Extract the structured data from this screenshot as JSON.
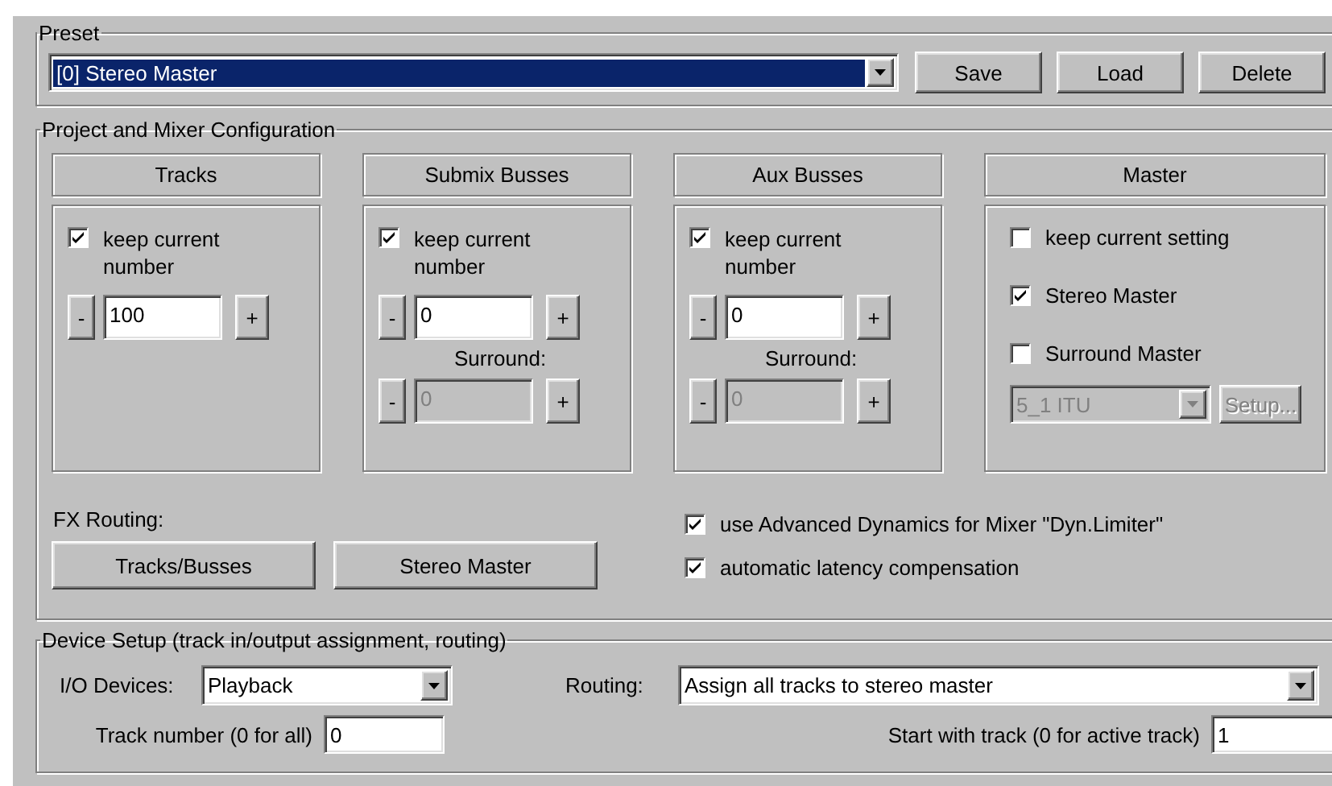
{
  "preset": {
    "title": "Preset",
    "selected": "[0] Stereo Master",
    "buttons": [
      "Save",
      "Load",
      "Delete"
    ]
  },
  "mixer": {
    "title": "Project and Mixer Configuration",
    "columns": [
      {
        "kind": "count",
        "title": "Tracks",
        "keep": {
          "label": "keep current number",
          "checked": true
        },
        "spin": {
          "minus": "-",
          "value": "100",
          "plus": "+"
        }
      },
      {
        "kind": "count",
        "title": "Submix Busses",
        "keep": {
          "label": "keep current number",
          "checked": true
        },
        "spin": {
          "minus": "-",
          "value": "0",
          "plus": "+"
        },
        "surround": {
          "label": "Surround:",
          "minus": "-",
          "value": "0",
          "plus": "+",
          "disabled": true
        }
      },
      {
        "kind": "count",
        "title": "Aux Busses",
        "keep": {
          "label": "keep current number",
          "checked": true
        },
        "spin": {
          "minus": "-",
          "value": "0",
          "plus": "+"
        },
        "surround": {
          "label": "Surround:",
          "minus": "-",
          "value": "0",
          "plus": "+",
          "disabled": true
        }
      },
      {
        "kind": "master",
        "title": "Master",
        "options": [
          {
            "label": "keep current setting",
            "checked": false
          },
          {
            "label": "Stereo Master",
            "checked": true
          },
          {
            "label": "Surround Master",
            "checked": false
          }
        ],
        "format": {
          "value": "5_1 ITU",
          "disabled": true
        },
        "setup": {
          "label": "Setup...",
          "disabled": true
        }
      }
    ],
    "fx_routing": {
      "label": "FX Routing:",
      "buttons": [
        "Tracks/Busses",
        "Stereo Master"
      ]
    },
    "options": [
      {
        "label": "use Advanced Dynamics for Mixer \"Dyn.Limiter\"",
        "checked": true
      },
      {
        "label": "automatic latency compensation",
        "checked": true
      }
    ]
  },
  "device": {
    "title": "Device Setup (track in/output assignment, routing)",
    "io_devices": {
      "label": "I/O Devices:",
      "value": "Playback"
    },
    "routing": {
      "label": "Routing:",
      "value": "Assign all tracks to stereo master"
    },
    "track_number": {
      "label": "Track number (0 for all)",
      "value": "0"
    },
    "start_track": {
      "label": "Start with track (0 for active track)",
      "value": "1"
    }
  }
}
